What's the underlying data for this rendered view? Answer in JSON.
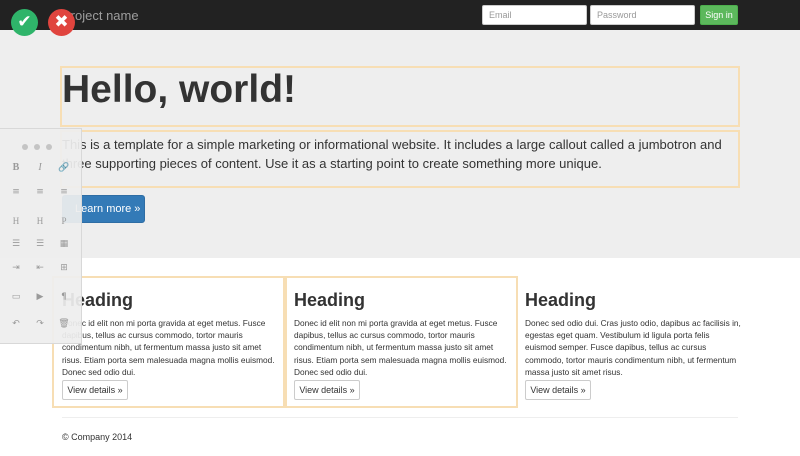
{
  "navbar": {
    "brand": "Project name",
    "email_placeholder": "Email",
    "password_placeholder": "Password",
    "signin_label": "Sign in"
  },
  "overlay": {
    "accept_glyph": "✔",
    "reject_glyph": "✖"
  },
  "jumbotron": {
    "title": "Hello, world!",
    "text": "This is a template for a simple marketing or informational website. It includes a large callout called a jumbotron and three supporting pieces of content. Use it as a starting point to create something more unique.",
    "button_label": "Learn more »"
  },
  "columns": [
    {
      "heading": "Heading",
      "text": "Donec id elit non mi porta gravida at eget metus. Fusce dapibus, tellus ac cursus commodo, tortor mauris condimentum nibh, ut fermentum massa justo sit amet risus. Etiam porta sem malesuada magna mollis euismod. Donec sed odio dui.",
      "button_label": "View details »"
    },
    {
      "heading": "Heading",
      "text": "Donec id elit non mi porta gravida at eget metus. Fusce dapibus, tellus ac cursus commodo, tortor mauris condimentum nibh, ut fermentum massa justo sit amet risus. Etiam porta sem malesuada magna mollis euismod. Donec sed odio dui.",
      "button_label": "View details »"
    },
    {
      "heading": "Heading",
      "text": "Donec sed odio dui. Cras justo odio, dapibus ac facilisis in, egestas eget quam. Vestibulum id ligula porta felis euismod semper. Fusce dapibus, tellus ac cursus commodo, tortor mauris condimentum nibh, ut fermentum massa justo sit amet risus.",
      "button_label": "View details »"
    }
  ],
  "footer": {
    "text": "© Company 2014"
  },
  "toolbar": {
    "bold": "B",
    "italic": "I",
    "link": "🔗",
    "align_left": "≡",
    "align_center": "≡",
    "align_right": "≡",
    "h1": "H",
    "h2": "H",
    "paragraph": "P",
    "bullet_list": "☰",
    "numbered_list": "☰",
    "table": "▦",
    "indent": "⇥",
    "outdent": "⇤",
    "insert": "⊞",
    "image": "▭",
    "video": "▶",
    "code": "¶",
    "undo": "↶",
    "redo": "↷",
    "delete": "🗑"
  },
  "colors": {
    "navbar_bg": "#222222",
    "jumbotron_bg": "#eeeeee",
    "primary": "#337ab7",
    "success": "#5cb85c",
    "accept": "#2fb46a",
    "reject": "#e0443e",
    "highlight_outline": "#f7deb4"
  }
}
